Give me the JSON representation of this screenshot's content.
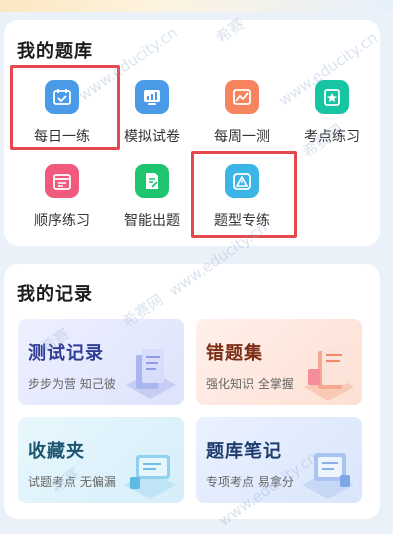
{
  "bank": {
    "title": "我的题库",
    "items": [
      {
        "label": "每日一练",
        "icon": "calendar-check-icon",
        "color": "#4a9ae8"
      },
      {
        "label": "模拟试卷",
        "icon": "chart-paper-icon",
        "color": "#4a9ae8"
      },
      {
        "label": "每周一测",
        "icon": "trend-chart-icon",
        "color": "#f6845e"
      },
      {
        "label": "考点练习",
        "icon": "star-clipboard-icon",
        "color": "#17c5a3"
      },
      {
        "label": "顺序练习",
        "icon": "list-calendar-icon",
        "color": "#f15a7c"
      },
      {
        "label": "智能出题",
        "icon": "edit-document-icon",
        "color": "#1ec46e"
      },
      {
        "label": "题型专练",
        "icon": "warning-triangle-icon",
        "color": "#3ab5e6"
      }
    ]
  },
  "records": {
    "title": "我的记录",
    "cards": [
      {
        "title": "测试记录",
        "subtitle": "步步为营 知己彼",
        "title_color": "#2f3f96"
      },
      {
        "title": "错题集",
        "subtitle": "强化知识 全掌握",
        "title_color": "#7a2d14"
      },
      {
        "title": "收藏夹",
        "subtitle": "试题考点 无偏漏",
        "title_color": "#1b5570"
      },
      {
        "title": "题库笔记",
        "subtitle": "专项考点 易拿分",
        "title_color": "#1e3d6e"
      }
    ]
  },
  "watermark": {
    "brand": "希赛",
    "site": "www.educity.cn",
    "net": "希赛网"
  }
}
